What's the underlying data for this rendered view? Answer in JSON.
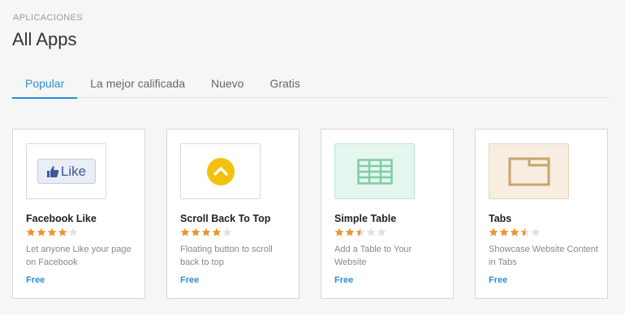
{
  "section_label": "APLICACIONES",
  "page_title": "All Apps",
  "tabs": [
    {
      "label": "Popular",
      "active": true
    },
    {
      "label": "La mejor calificada",
      "active": false
    },
    {
      "label": "Nuevo",
      "active": false
    },
    {
      "label": "Gratis",
      "active": false
    }
  ],
  "apps": [
    {
      "name": "Facebook Like",
      "rating": 4,
      "rating_max": 5,
      "description": "Let anyone Like your page on Facebook",
      "price": "Free",
      "icon": "facebook-like-icon",
      "icon_text": "Like",
      "thumb_bg": "#ffffff"
    },
    {
      "name": "Scroll Back To Top",
      "rating": 4,
      "rating_max": 5,
      "description": "Floating button to scroll back to top",
      "price": "Free",
      "icon": "scroll-up-icon",
      "thumb_bg": "#ffffff"
    },
    {
      "name": "Simple Table",
      "rating": 2.5,
      "rating_max": 5,
      "description": "Add a Table to Your Website",
      "price": "Free",
      "icon": "table-icon",
      "thumb_bg": "#e4f6ee"
    },
    {
      "name": "Tabs",
      "rating": 3.5,
      "rating_max": 5,
      "description": "Showcase Website Content in Tabs",
      "price": "Free",
      "icon": "tabs-icon",
      "thumb_bg": "#f7ede1"
    }
  ],
  "colors": {
    "accent": "#2b8ed8",
    "star_filled": "#f0932b",
    "star_empty": "#e0e0e0",
    "scroll_icon": "#f3c10d",
    "table_icon": "#7fcca4",
    "tabs_icon": "#c9a46c"
  }
}
